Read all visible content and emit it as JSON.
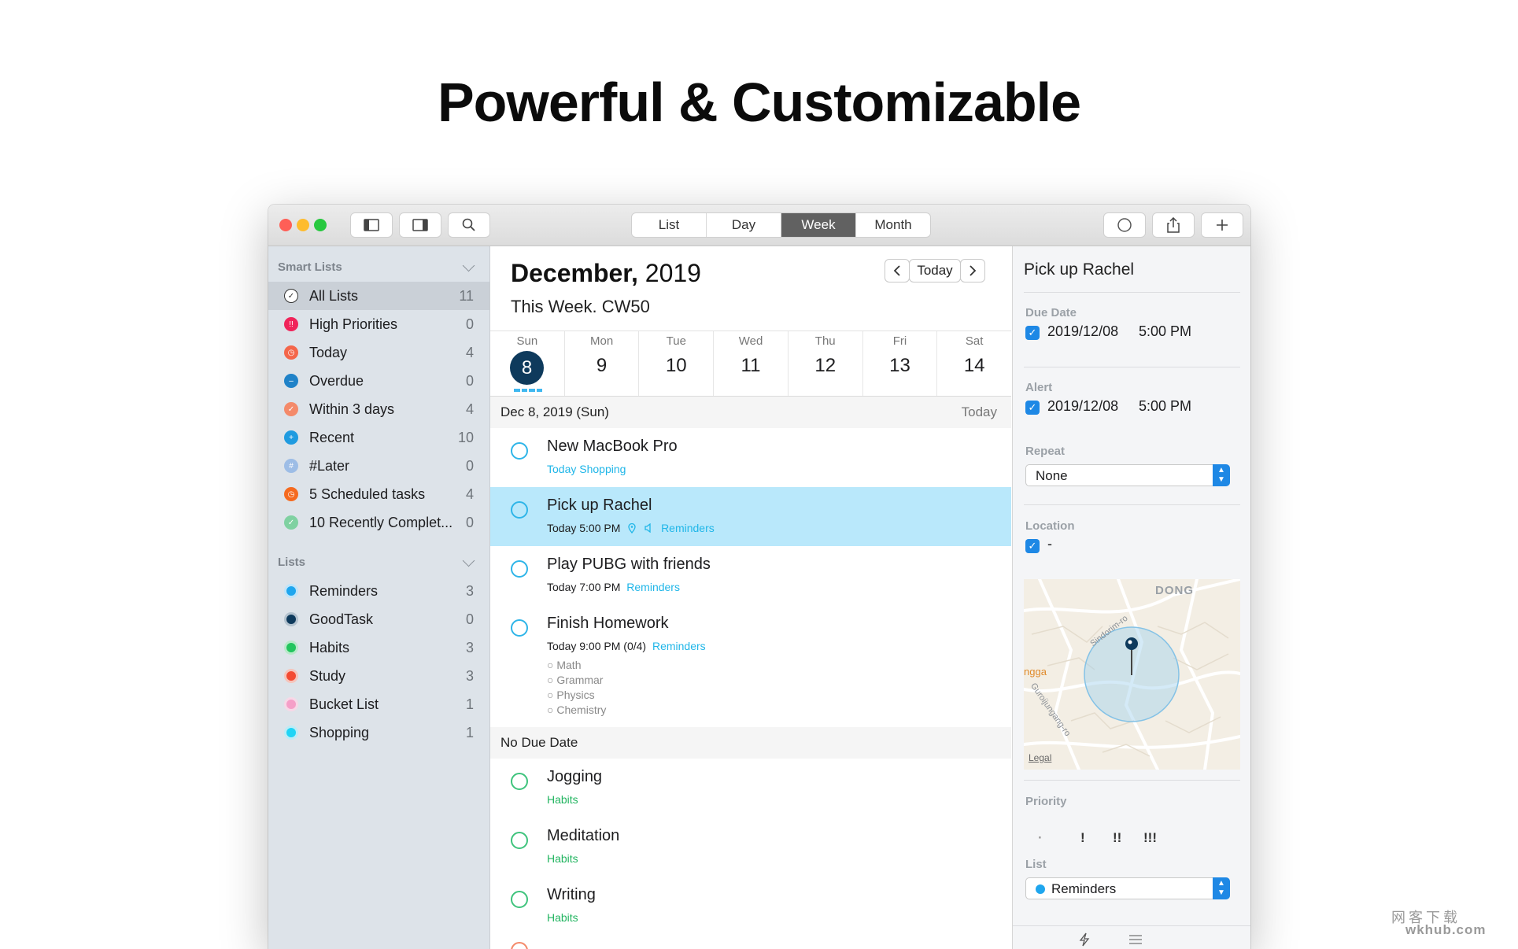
{
  "headline": "Powerful & Customizable",
  "toolbar": {
    "view_tabs": [
      "List",
      "Day",
      "Week",
      "Month"
    ],
    "active_view": "Week"
  },
  "sidebar": {
    "smart_header": "Smart Lists",
    "smart": [
      {
        "label": "All Lists",
        "count": "11",
        "color": "#ffffff",
        "icon": "check-circle-icon"
      },
      {
        "label": "High Priorities",
        "count": "0",
        "color": "#f0245a",
        "icon": "exclamation-icon"
      },
      {
        "label": "Today",
        "count": "4",
        "color": "#f4664a",
        "icon": "clock-icon"
      },
      {
        "label": "Overdue",
        "count": "0",
        "color": "#1f82c8",
        "icon": "minus-icon"
      },
      {
        "label": "Within 3 days",
        "count": "4",
        "color": "#f48a6a",
        "icon": "check-icon"
      },
      {
        "label": "Recent",
        "count": "10",
        "color": "#1f9be0",
        "icon": "plus-icon"
      },
      {
        "label": "#Later",
        "count": "0",
        "color": "#9dbde6",
        "icon": "hashtag-icon"
      },
      {
        "label": "5 Scheduled tasks",
        "count": "4",
        "color": "#f56a1f",
        "icon": "clock-icon"
      },
      {
        "label": "10 Recently Complet...",
        "count": "0",
        "color": "#7fd1a1",
        "icon": "check-icon"
      }
    ],
    "lists_header": "Lists",
    "lists": [
      {
        "label": "Reminders",
        "count": "3",
        "color": "#1fa6ee"
      },
      {
        "label": "GoodTask",
        "count": "0",
        "color": "#0e3a5c"
      },
      {
        "label": "Habits",
        "count": "3",
        "color": "#22c55e"
      },
      {
        "label": "Study",
        "count": "3",
        "color": "#f34a32"
      },
      {
        "label": "Bucket List",
        "count": "1",
        "color": "#f59fc8"
      },
      {
        "label": "Shopping",
        "count": "1",
        "color": "#1fd4f5"
      }
    ]
  },
  "main": {
    "month_bold": "December,",
    "year": "2019",
    "week_label": "This Week. CW50",
    "today_button": "Today",
    "days": [
      {
        "name": "Sun",
        "num": "8"
      },
      {
        "name": "Mon",
        "num": "9"
      },
      {
        "name": "Tue",
        "num": "10"
      },
      {
        "name": "Wed",
        "num": "11"
      },
      {
        "name": "Thu",
        "num": "12"
      },
      {
        "name": "Fri",
        "num": "13"
      },
      {
        "name": "Sat",
        "num": "14"
      }
    ],
    "group1": {
      "label": "Dec 8, 2019 (Sun)",
      "right": "Today"
    },
    "group2": {
      "label": "No Due Date"
    },
    "tasks": [
      {
        "title": "New MacBook Pro",
        "meta": "",
        "tags": "Today Shopping"
      },
      {
        "title": "Pick up Rachel",
        "meta": "Today 5:00 PM",
        "tags": "Reminders"
      },
      {
        "title": "Play PUBG with friends",
        "meta": "Today 7:00 PM",
        "tags": "Reminders"
      },
      {
        "title": "Finish Homework",
        "meta": "Today 9:00 PM (0/4)",
        "tags": "Reminders",
        "subtasks": [
          "Math",
          "Grammar",
          "Physics",
          "Chemistry"
        ]
      },
      {
        "title": "Jogging",
        "meta": "",
        "tags": "Habits"
      },
      {
        "title": "Meditation",
        "meta": "",
        "tags": "Habits"
      },
      {
        "title": "Writing",
        "meta": "",
        "tags": "Habits"
      }
    ]
  },
  "detail": {
    "title": "Pick up Rachel",
    "due_label": "Due Date",
    "due_date": "2019/12/08",
    "due_time": "5:00 PM",
    "alert_label": "Alert",
    "alert_date": "2019/12/08",
    "alert_time": "5:00 PM",
    "repeat_label": "Repeat",
    "repeat_value": "None",
    "location_label": "Location",
    "location_value": "-",
    "map_labels": {
      "district": "DONG",
      "area": "ngga",
      "road": "Sindorim-ro",
      "road2": "Guroijungang-ro",
      "legal": "Legal"
    },
    "priority_label": "Priority",
    "priorities": [
      "·",
      "!",
      "!!",
      "!!!"
    ],
    "list_label": "List",
    "list_value": "Reminders"
  },
  "watermark": {
    "line1": "网客下载",
    "line2": "wkhub.com"
  }
}
